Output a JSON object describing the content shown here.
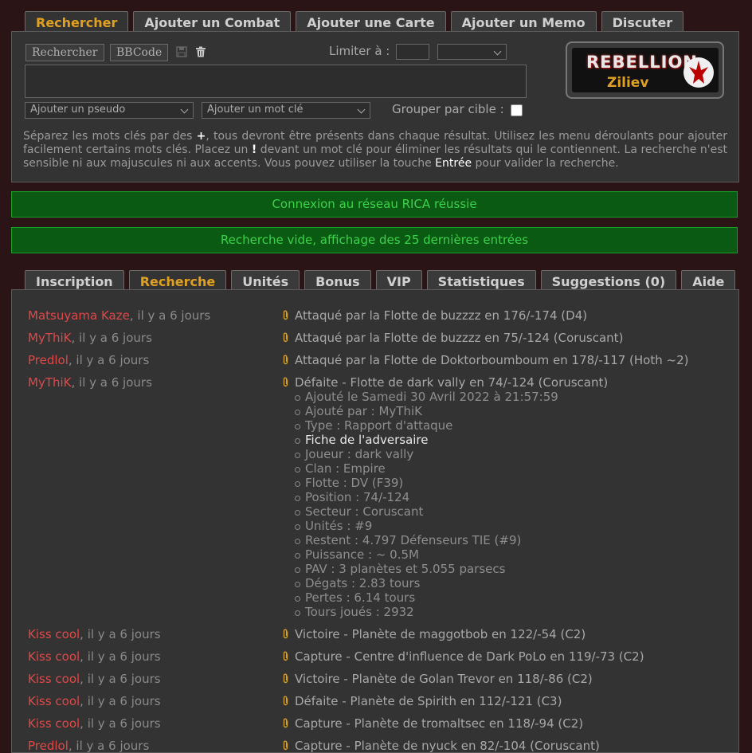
{
  "top_tabs": [
    "Rechercher",
    "Ajouter un Combat",
    "Ajouter une Carte",
    "Ajouter un Memo",
    "Discuter"
  ],
  "search": {
    "btn_search": "Rechercher",
    "btn_bbcode": "BBCode",
    "limit_label": "Limiter à :",
    "pseudo_select": "Ajouter un pseudo",
    "keyword_select": "Ajouter un mot clé",
    "group_label": "Grouper par cible :",
    "help_1": "Séparez les mots clés par des ",
    "help_plus": "+",
    "help_2": ", tous devront être présents dans chaque résultat. Utilisez les menu déroulants pour ajouter facilement certains mots clés. Placez un ",
    "help_bang": "!",
    "help_3": " devant un mot clé pour éliminer les résultats qui le contiennent. La recherche n'est sensible ni aux majuscules ni aux accents. Vous pouvez utiliser la touche ",
    "help_enter": "Entrée",
    "help_4": " pour valider la recherche."
  },
  "logo": {
    "text": "REBELLION",
    "user": "Ziliev"
  },
  "banners": {
    "connect": "Connexion au réseau RICA réussie",
    "empty": "Recherche vide, affichage des 25 dernières entrées"
  },
  "bottom_tabs": [
    "Inscription",
    "Recherche",
    "Unités",
    "Bonus",
    "VIP",
    "Statistiques",
    "Suggestions (0)",
    "Aide"
  ],
  "entries": [
    {
      "name": "Matsuyama Kaze",
      "ago": ", il y a 6 jours",
      "event": "Attaqué par la Flotte de buzzzz en 176/-174 (D4)"
    },
    {
      "name": "MyThiK",
      "ago": ", il y a 6 jours",
      "event": "Attaqué par la Flotte de buzzzz en 75/-124 (Coruscant)"
    },
    {
      "name": "Predlol",
      "ago": ", il y a 6 jours",
      "event": "Attaqué par la Flotte de Doktorboumboum en 178/-117 (Hoth ~2)"
    },
    {
      "name": "MyThiK",
      "ago": ", il y a 6 jours",
      "event": "Défaite - Flotte de dark vally en 74/-124 (Coruscant)"
    },
    {
      "name": "Kiss cool",
      "ago": ", il y a 6 jours",
      "event": "Victoire - Planète de maggotbob en 122/-54 (C2)"
    },
    {
      "name": "Kiss cool",
      "ago": ", il y a 6 jours",
      "event": "Capture - Centre d'influence de Dark PoLo en 119/-73 (C2)"
    },
    {
      "name": "Kiss cool",
      "ago": ", il y a 6 jours",
      "event": "Victoire - Planète de Golan Trevor en 118/-86 (C2)"
    },
    {
      "name": "Kiss cool",
      "ago": ", il y a 6 jours",
      "event": "Défaite - Planète de Spirith en 112/-121 (C3)"
    },
    {
      "name": "Kiss cool",
      "ago": ", il y a 6 jours",
      "event": "Capture - Planète de tromaltsec en 118/-94 (C2)"
    },
    {
      "name": "Predlol",
      "ago": ", il y a 6 jours",
      "event": "Capture - Planète de nyuck en 82/-104 (Coruscant)"
    }
  ],
  "details": [
    "Ajouté le Samedi 30 Avril 2022 à 21:57:59",
    "Ajouté par : MyThiK",
    "Type : Rapport d'attaque",
    "Fiche de l'adversaire",
    "Joueur : dark vally",
    "Clan : Empire",
    "Flotte : DV (F39)",
    "Position : 74/-124",
    "Secteur : Coruscant",
    "Unités : #9",
    "Restent : 4.797 Défenseurs TIE (#9)",
    "Puissance : ~ 0.5M",
    "PAV : 3 planètes et 5.055 parsecs",
    "Dégats : 2.83 tours",
    "Pertes : 6.14 tours",
    "Tours joués : 2932"
  ]
}
